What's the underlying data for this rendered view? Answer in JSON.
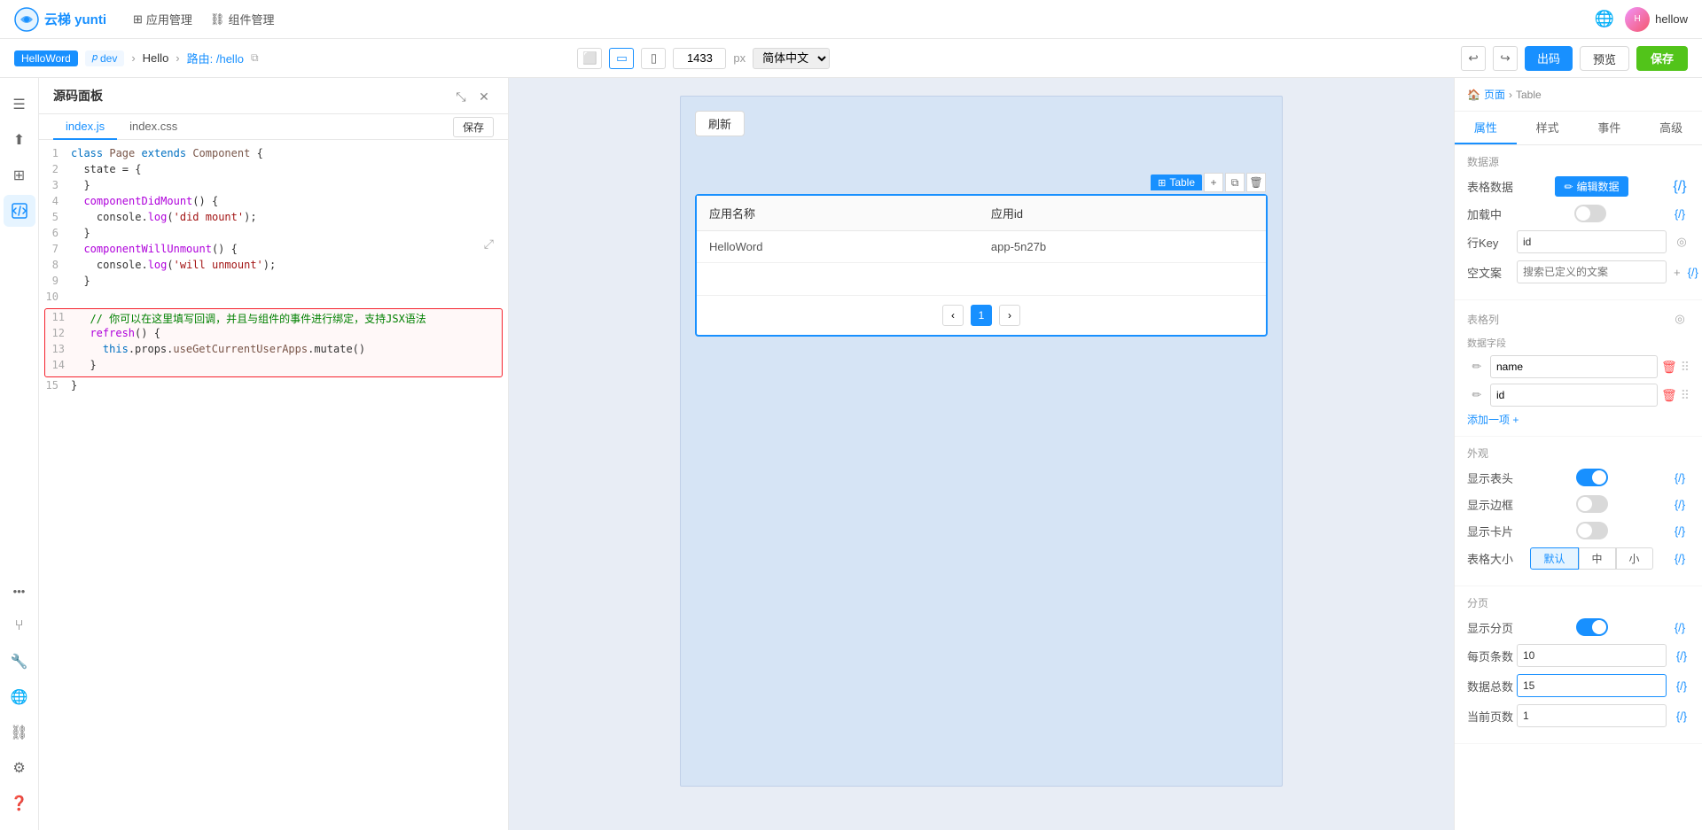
{
  "topNav": {
    "logo": "云梯 yunti",
    "menus": [
      {
        "label": "应用管理",
        "icon": "grid"
      },
      {
        "label": "组件管理",
        "icon": "component"
      }
    ],
    "user": "hellow",
    "globalIcon": "🌐"
  },
  "secondBar": {
    "appTag": "HelloWord",
    "branchTag": "dev",
    "breadcrumb": [
      "Hello",
      "路由: /hello"
    ],
    "viewWidth": "1433",
    "viewUnit": "px",
    "language": "简体中文",
    "exportBtn": "出码",
    "previewBtn": "预览",
    "saveBtn": "保存"
  },
  "sourcePanel": {
    "title": "源码面板",
    "tabs": [
      "index.js",
      "index.css"
    ],
    "activeTab": "index.js",
    "saveBtn": "保存",
    "lines": [
      {
        "num": 1,
        "content": "class Page extends Component {",
        "type": "class"
      },
      {
        "num": 2,
        "content": "  state = {",
        "type": "normal"
      },
      {
        "num": 3,
        "content": "  }",
        "type": "normal"
      },
      {
        "num": 4,
        "content": "  componentDidMount() {",
        "type": "method"
      },
      {
        "num": 5,
        "content": "    console.log('did mount');",
        "type": "log"
      },
      {
        "num": 6,
        "content": "  }",
        "type": "normal"
      },
      {
        "num": 7,
        "content": "  componentWillUnmount() {",
        "type": "method"
      },
      {
        "num": 8,
        "content": "    console.log('will unmount');",
        "type": "log"
      },
      {
        "num": 9,
        "content": "  }",
        "type": "normal"
      },
      {
        "num": 10,
        "content": "",
        "type": "empty"
      },
      {
        "num": 11,
        "content": "  // 你可以在这里填写回调，并且与组件的事件进行绑定，支持JSX语法",
        "type": "comment"
      },
      {
        "num": 12,
        "content": "  refresh() {",
        "type": "method"
      },
      {
        "num": 13,
        "content": "    this.props.useGetCurrentUserApps.mutate()",
        "type": "code"
      },
      {
        "num": 14,
        "content": "  }",
        "type": "normal"
      },
      {
        "num": 15,
        "content": "}",
        "type": "normal"
      }
    ]
  },
  "canvas": {
    "refreshBtn": "刷新",
    "tableLabel": "Table",
    "tableHeaders": [
      "应用名称",
      "应用id"
    ],
    "tableRows": [
      {
        "name": "HelloWord",
        "id": "app-5n27b"
      }
    ],
    "pagination": {
      "current": 1
    }
  },
  "rightPanel": {
    "breadcrumb": [
      "页面",
      "Table"
    ],
    "tabs": [
      "属性",
      "样式",
      "事件",
      "高级"
    ],
    "activeTab": "属性",
    "sections": {
      "datasource": {
        "title": "数据源",
        "tableDataLabel": "表格数据",
        "editDataBtn": "编辑数据",
        "loadingLabel": "加载中",
        "rowKeyLabel": "行Key",
        "rowKeyValue": "id",
        "emptyLabel": "空文案",
        "emptyPlaceholder": "搜索已定义的文案"
      },
      "columns": {
        "title": "表格列",
        "fieldLabel": "数据字段",
        "items": [
          "name",
          "id"
        ],
        "addLabel": "添加一项 +"
      },
      "appearance": {
        "title": "外观",
        "showHeader": true,
        "showHeader_label": "显示表头",
        "showBorder": false,
        "showBorder_label": "显示边框",
        "showCard": false,
        "showCard_label": "显示卡片",
        "sizeLabel": "表格大小",
        "sizes": [
          "默认",
          "中",
          "小"
        ],
        "activeSize": "默认"
      },
      "pagination": {
        "title": "分页",
        "showPagination": true,
        "showPagination_label": "显示分页",
        "perPageLabel": "每页条数",
        "perPageValue": "10",
        "totalLabel": "数据总数",
        "totalValue": "15",
        "currentPageLabel": "当前页数",
        "currentPageValue": "1"
      }
    }
  },
  "leftSidebar": {
    "icons": [
      "☰",
      "⬆",
      "⊞",
      "📋",
      "⚙",
      "🔗",
      "🔧",
      "🌐",
      "🔀",
      "⚙",
      "❓"
    ]
  }
}
